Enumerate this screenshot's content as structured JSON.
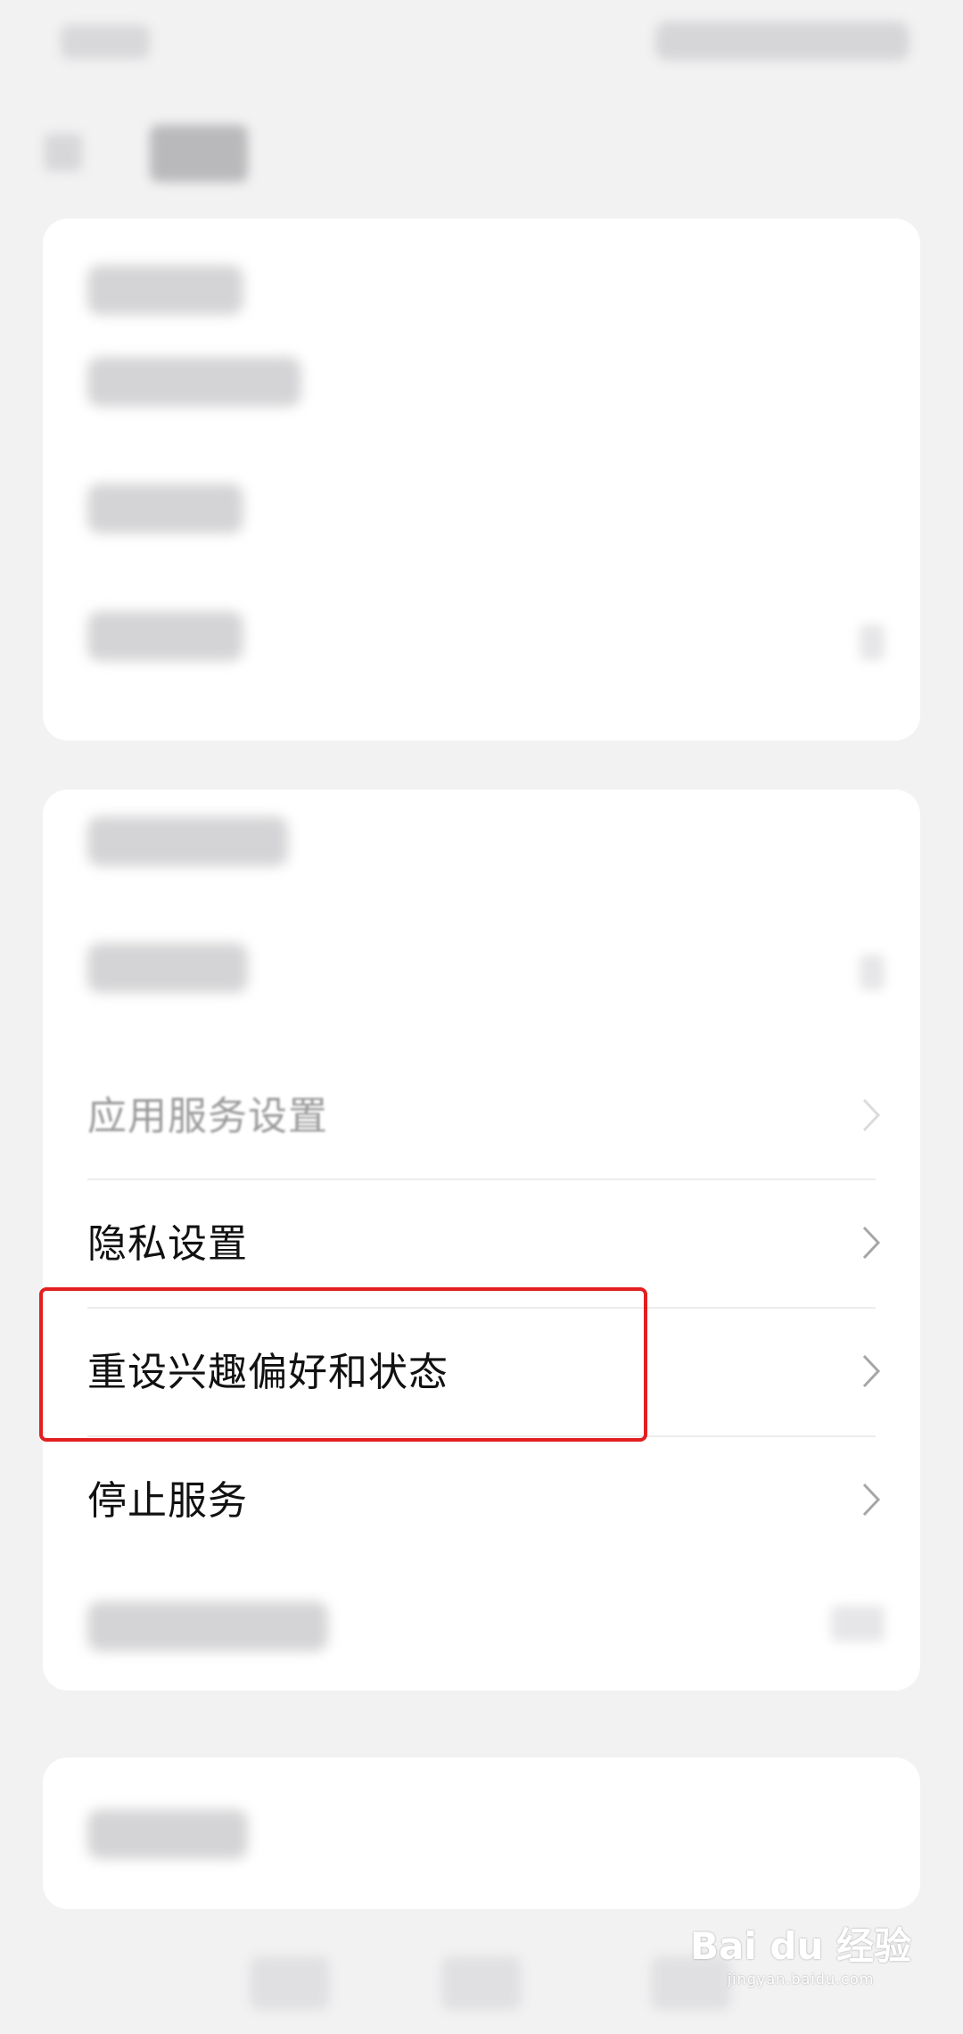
{
  "menu": {
    "items": [
      {
        "label": "应用服务设置",
        "state": "faded"
      },
      {
        "label": "隐私设置"
      },
      {
        "label": "重设兴趣偏好和状态",
        "highlighted": true
      },
      {
        "label": "停止服务"
      }
    ]
  },
  "colors": {
    "highlight_border": "#e21f1f",
    "background": "#f2f2f3",
    "card": "#ffffff"
  },
  "watermark": {
    "text": "Bai du 经验",
    "sub": "jingyan.baidu.com"
  }
}
